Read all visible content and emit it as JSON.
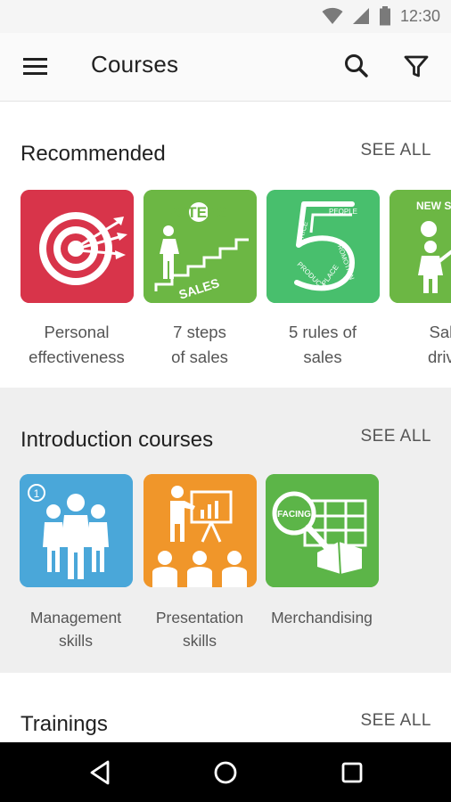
{
  "status_bar": {
    "time": "12:30",
    "icons": [
      "wifi-icon",
      "signal-icon",
      "battery-icon"
    ]
  },
  "app_bar": {
    "title": "Courses",
    "icons": [
      "menu-icon",
      "search-icon",
      "filter-icon"
    ]
  },
  "sections": {
    "recommended": {
      "title": "Recommended",
      "see_all": "SEE ALL",
      "courses": [
        {
          "line1": "Personal",
          "line2": "effectiveness",
          "tile_text": "",
          "color": "#d8344a"
        },
        {
          "line1": "7 steps",
          "line2": "of sales",
          "tile_text": "7STEPS",
          "color": "#6cb744"
        },
        {
          "line1": "5 rules of",
          "line2": "sales",
          "tile_text": "5",
          "color": "#48bf6d"
        },
        {
          "line1": "Sale",
          "line2": "drive",
          "tile_text": "NEW SA",
          "color": "#6cb744"
        }
      ]
    },
    "introduction": {
      "title": "Introduction courses",
      "see_all": "SEE ALL",
      "courses": [
        {
          "line1": "Management",
          "line2": "skills",
          "tile_text": "1",
          "color": "#4aa7d9"
        },
        {
          "line1": "Presentation",
          "line2": "skills",
          "tile_text": "",
          "color": "#f0962a"
        },
        {
          "line1": "Merchandising",
          "line2": "",
          "tile_text": "FACING",
          "color": "#5cb548"
        }
      ]
    },
    "trainings": {
      "title": "Trainings",
      "see_all": "SEE ALL"
    }
  },
  "tile_words": {
    "people": "PEOPLE",
    "price": "PRICE",
    "promotion": "PROMOTION",
    "product": "PRODUCT",
    "place": "PLACE",
    "sales": "SALES"
  },
  "nav_bar": {
    "icons": [
      "back-icon",
      "home-icon",
      "recents-icon"
    ]
  }
}
